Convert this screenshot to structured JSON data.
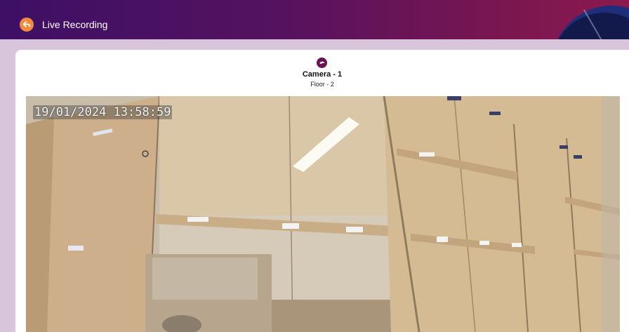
{
  "header": {
    "title": "Live Recording",
    "back_icon": "back-arrow-icon",
    "accent_color": "#f08a3c"
  },
  "camera": {
    "icon": "camera-icon",
    "name": "Camera - 1",
    "floor": "Floor - 2"
  },
  "feed": {
    "timestamp": "19/01/2024 13:58:59"
  }
}
